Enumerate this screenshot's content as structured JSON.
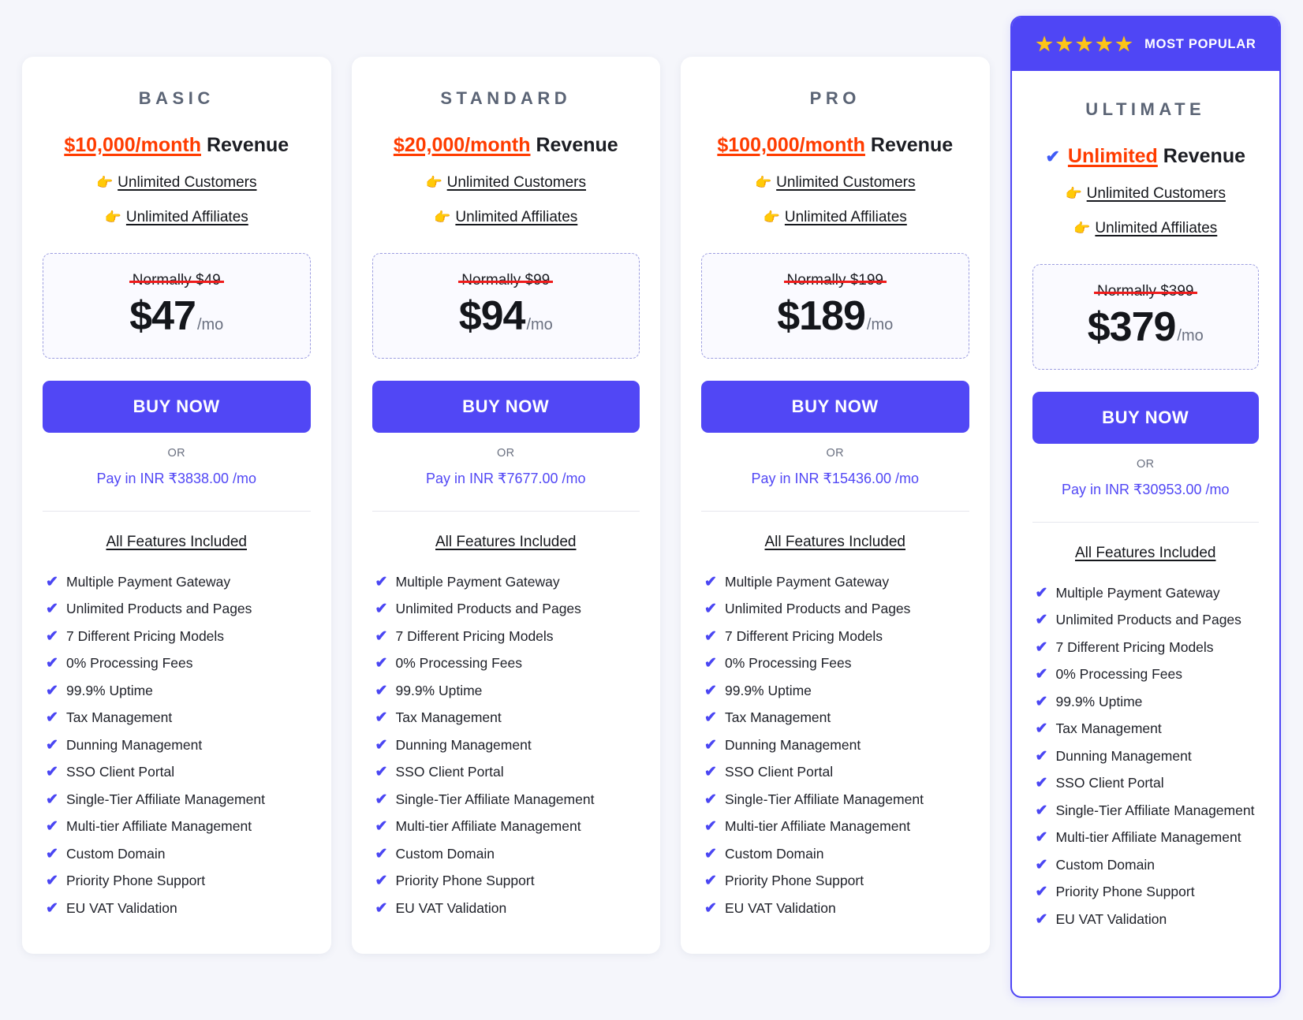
{
  "background_color": "#f5f6fb",
  "accent_color": "#5147f5",
  "highlight_color": "#ff3c00",
  "banner": {
    "label": "MOST POPULAR",
    "star_icon": "★",
    "star_count": 5
  },
  "labels": {
    "buy_now": "BUY NOW",
    "or": "OR",
    "normally_prefix": "Normally",
    "period": "/mo",
    "features_title": "All Features Included",
    "revenue_suffix": "Revenue",
    "point_icon": "👉",
    "check_icon": "✔"
  },
  "features": [
    "Multiple Payment Gateway",
    "Unlimited Products and Pages",
    "7 Different Pricing Models",
    "0% Processing Fees",
    "99.9% Uptime",
    "Tax Management",
    "Dunning Management",
    "SSO Client Portal",
    "Single-Tier Affiliate Management",
    "Multi-tier Affiliate Management",
    "Custom Domain",
    "Priority Phone Support",
    "EU VAT Validation"
  ],
  "plans": [
    {
      "name": "BASIC",
      "featured": false,
      "revenue_amount": "$10,000/month",
      "revenue_suffix": "Revenue",
      "bullets": [
        "Unlimited Customers",
        "Unlimited Affiliates"
      ],
      "normally": "Normally $49",
      "price": "$47",
      "period": "/mo",
      "cta": "BUY NOW",
      "inr": "Pay in INR ₹3838.00 /mo"
    },
    {
      "name": "STANDARD",
      "featured": false,
      "revenue_amount": "$20,000/month",
      "revenue_suffix": "Revenue",
      "bullets": [
        "Unlimited Customers",
        "Unlimited Affiliates"
      ],
      "normally": "Normally $99",
      "price": "$94",
      "period": "/mo",
      "cta": "BUY NOW",
      "inr": "Pay in INR ₹7677.00 /mo"
    },
    {
      "name": "PRO",
      "featured": false,
      "revenue_amount": "$100,000/month",
      "revenue_suffix": "Revenue",
      "bullets": [
        "Unlimited Customers",
        "Unlimited Affiliates"
      ],
      "normally": "Normally $199",
      "price": "$189",
      "period": "/mo",
      "cta": "BUY NOW",
      "inr": "Pay in INR ₹15436.00 /mo"
    },
    {
      "name": "ULTIMATE",
      "featured": true,
      "revenue_amount": "Unlimited",
      "revenue_suffix": "Revenue",
      "bullets": [
        "Unlimited Customers",
        "Unlimited Affiliates"
      ],
      "normally": "Normally $399",
      "price": "$379",
      "period": "/mo",
      "cta": "BUY NOW",
      "inr": "Pay in INR ₹30953.00 /mo"
    }
  ]
}
